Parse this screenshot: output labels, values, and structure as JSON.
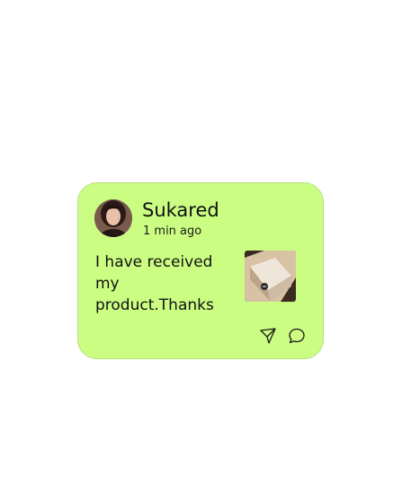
{
  "card": {
    "background": "#cbfd83",
    "author": {
      "name": "Sukared",
      "time": "1 min ago",
      "avatar_icon": "user-photo"
    },
    "message": "I have received my product.Thanks",
    "attachment_icon": "package-photo",
    "actions": [
      {
        "icon": "send-icon"
      },
      {
        "icon": "comment-icon"
      }
    ]
  }
}
